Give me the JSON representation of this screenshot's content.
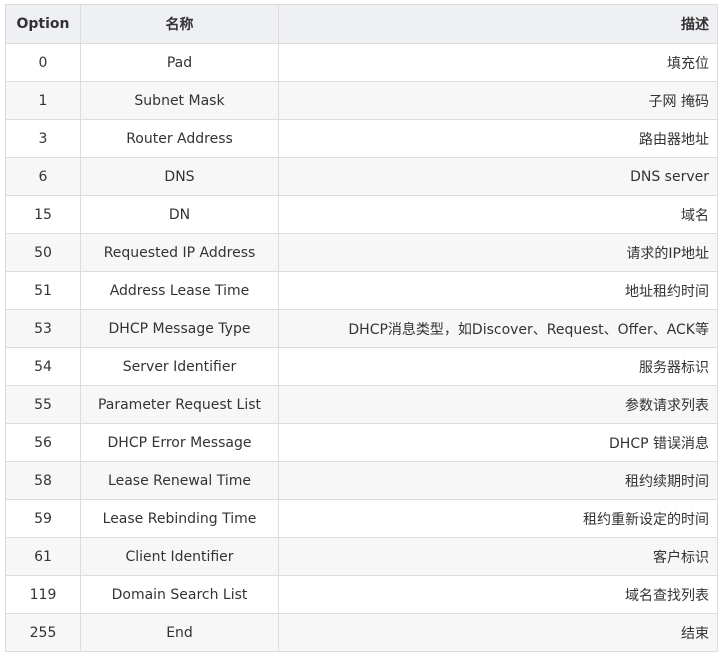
{
  "table": {
    "headers": {
      "option": "Option",
      "name": "名称",
      "desc": "描述"
    },
    "rows": [
      {
        "option": "0",
        "name": "Pad",
        "desc": "填充位"
      },
      {
        "option": "1",
        "name": "Subnet Mask",
        "desc": "子网 掩码"
      },
      {
        "option": "3",
        "name": "Router Address",
        "desc": "路由器地址"
      },
      {
        "option": "6",
        "name": "DNS",
        "desc": "DNS server"
      },
      {
        "option": "15",
        "name": "DN",
        "desc": "域名"
      },
      {
        "option": "50",
        "name": "Requested IP Address",
        "desc": "请求的IP地址"
      },
      {
        "option": "51",
        "name": "Address Lease Time",
        "desc": "地址租约时间"
      },
      {
        "option": "53",
        "name": "DHCP Message Type",
        "desc": "DHCP消息类型，如Discover、Request、Offer、ACK等"
      },
      {
        "option": "54",
        "name": "Server Identifier",
        "desc": "服务器标识"
      },
      {
        "option": "55",
        "name": "Parameter Request List",
        "desc": "参数请求列表"
      },
      {
        "option": "56",
        "name": "DHCP Error Message",
        "desc": "DHCP 错误消息"
      },
      {
        "option": "58",
        "name": "Lease Renewal Time",
        "desc": "租约续期时间"
      },
      {
        "option": "59",
        "name": "Lease Rebinding Time",
        "desc": "租约重新设定的时间"
      },
      {
        "option": "61",
        "name": "Client Identifier",
        "desc": "客户标识"
      },
      {
        "option": "119",
        "name": "Domain Search List",
        "desc": "域名查找列表"
      },
      {
        "option": "255",
        "name": "End",
        "desc": "结束"
      }
    ]
  },
  "colors": {
    "header_bg": "#eef0f3",
    "stripe_bg": "#f7f7f7",
    "border": "#dcdcdc",
    "text": "#333333"
  }
}
